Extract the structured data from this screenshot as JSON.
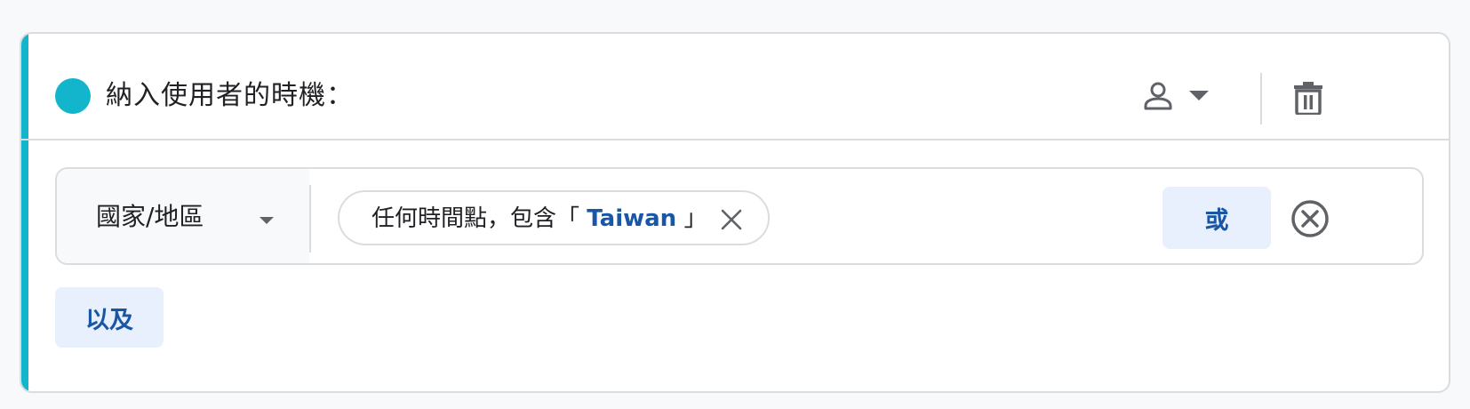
{
  "card": {
    "title": "納入使用者的時機：",
    "accent_color": "#12b5cb",
    "header_icons": {
      "scope": "person-icon",
      "scope_dropdown": "chevron-down-icon",
      "delete": "trash-icon"
    }
  },
  "condition": {
    "dimension_label": "國家/地區",
    "dimension_icon": "chevron-down-icon",
    "chip": {
      "prefix": "任何時間點，包含「 ",
      "value": "Taiwan",
      "suffix": " 」",
      "close_icon": "close-icon"
    },
    "or_label": "或",
    "remove_icon": "circle-x-icon"
  },
  "and_label": "以及",
  "colors": {
    "accent": "#12b5cb",
    "link_blue": "#1a56a6",
    "button_bg": "#e8f0fe",
    "border": "#dadce0",
    "icon_gray": "#5f6368"
  }
}
